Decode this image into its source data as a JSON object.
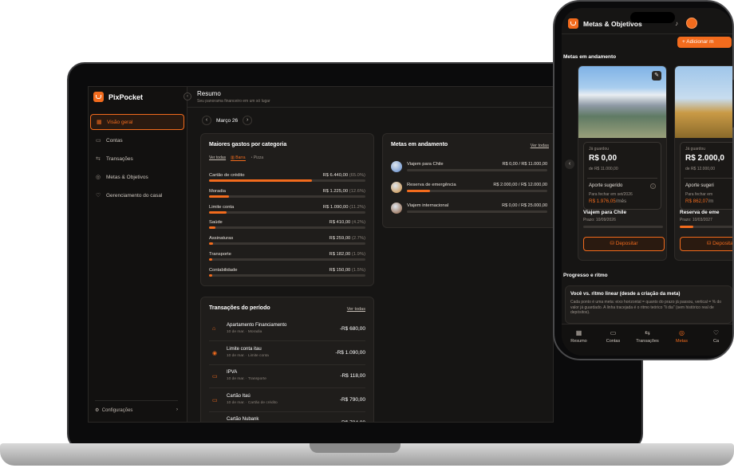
{
  "app": {
    "name": "PixPocket"
  },
  "sidebar": {
    "items": [
      {
        "label": "Visão geral",
        "icon": "grid-icon",
        "glyph": "▦",
        "active": true
      },
      {
        "label": "Contas",
        "icon": "wallet-icon",
        "glyph": "▭"
      },
      {
        "label": "Transações",
        "icon": "swap-icon",
        "glyph": "⇆"
      },
      {
        "label": "Metas & Objetivos",
        "icon": "target-icon",
        "glyph": "◎"
      },
      {
        "label": "Gerenciamento do casal",
        "icon": "heart-icon",
        "glyph": "♡"
      }
    ],
    "footer": {
      "label": "Configurações",
      "chevron": "›",
      "glyph": "⚙"
    }
  },
  "header": {
    "title": "Resumo",
    "subtitle": "Seu panorama financeiro em um só lugar",
    "collapse_glyph": "‹"
  },
  "period": {
    "label": "Março 26",
    "prev": "‹",
    "next": "›"
  },
  "categories": {
    "title": "Maiores gastos por categoria",
    "tabs": {
      "all": "Ver todas",
      "bars": "Barra",
      "pie": "Pizza"
    },
    "chart_data": {
      "type": "bar",
      "categories": [
        "Cartão de crédito",
        "Moradia",
        "Limite conta",
        "Saúde",
        "Assinaturas",
        "Transporte",
        "Contabilidade"
      ],
      "amounts": [
        "R$ 6.440,00",
        "R$ 1.225,00",
        "R$ 1.090,00",
        "R$ 410,00",
        "R$ 259,00",
        "R$ 182,00",
        "R$ 150,00"
      ],
      "percents": [
        "(65.0%)",
        "(12.6%)",
        "(11.2%)",
        "(4.2%)",
        "(2.7%)",
        "(1.9%)",
        "(1.5%)"
      ],
      "values": [
        65.0,
        12.6,
        11.2,
        4.2,
        2.7,
        1.9,
        1.5
      ]
    }
  },
  "goals": {
    "title": "Metas em andamento",
    "link": "Ver todas",
    "items": [
      {
        "name": "Viajem para Chile",
        "value": "R$ 0,00 / R$ 11.000,00",
        "progress": 0.0,
        "color": "#5a86c9"
      },
      {
        "name": "Reserva de emergência",
        "value": "R$ 2.000,00 / R$ 12.000,00",
        "progress": 0.1667,
        "color": "#c98a3a"
      },
      {
        "name": "Viajem internacional",
        "value": "R$ 0,00 / R$ 25.000,00",
        "progress": 0.0,
        "color": "#8a5a3a"
      }
    ]
  },
  "transactions": {
    "title": "Transações do período",
    "link": "Ver todas",
    "items": [
      {
        "name": "Apartamento Financiamento",
        "detail": "10 de mar. · Moradia",
        "amount": "-R$ 680,00",
        "glyph": "⌂"
      },
      {
        "name": "Limite conta itau",
        "detail": "10 de mar. · Limite conta",
        "amount": "-R$ 1.090,00",
        "glyph": "◉"
      },
      {
        "name": "IPVA",
        "detail": "10 de mar. · Transporte",
        "amount": "-R$ 118,00",
        "glyph": "▭"
      },
      {
        "name": "Cartão Itaú",
        "detail": "10 de mar. · Cartão de crédito",
        "amount": "-R$ 790,00",
        "glyph": "▭"
      },
      {
        "name": "Cartão Nubank",
        "detail": "",
        "amount": "-R$ 784,00",
        "glyph": "▭"
      }
    ]
  },
  "phone": {
    "title": "Metas & Objetivos",
    "add_button": "+ Adicionar m",
    "section_goals": "Metas em andamento",
    "cards": [
      {
        "saved_label": "Já guardou",
        "saved": "R$ 0,00",
        "of": "de R$ 11.000,00",
        "suggest_title": "Aporte sugerido",
        "suggest_sub": "Para fechar em set/2026",
        "suggest_value": "R$ 1.976,05",
        "suggest_unit": "/mês",
        "name": "Viajem para Chile",
        "date": "Prazo: 10/09/2026",
        "progress": 0.0,
        "deposit": "Depositar"
      },
      {
        "saved_label": "Já guardou",
        "saved": "R$ 2.000,0",
        "of": "de R$ 12.000,00",
        "suggest_title": "Aporte sugeri",
        "suggest_sub": "Para fechar em",
        "suggest_value": "R$ 862,07",
        "suggest_unit": "/m",
        "name": "Reserva de eme",
        "date": "Prazo: 10/03/2027",
        "progress": 0.1667,
        "deposit": "Deposital"
      }
    ],
    "section_progress": "Progresso e ritmo",
    "progress_card": {
      "title": "Você vs. ritmo linear (desde a criação da meta)",
      "desc": "Cada ponto é uma meta: eixo horizontal = quanto do prazo já passou, vertical = % do valor já guardado. A linha tracejada é o ritmo teórico \"li dia\" (sem histórico real de depósitos)."
    },
    "tabs": [
      {
        "label": "Resumo",
        "glyph": "▦"
      },
      {
        "label": "Contas",
        "glyph": "▭"
      },
      {
        "label": "Transações",
        "glyph": "⇆"
      },
      {
        "label": "Metas",
        "glyph": "◎",
        "active": true
      },
      {
        "label": "Ca",
        "glyph": "♡"
      }
    ]
  }
}
